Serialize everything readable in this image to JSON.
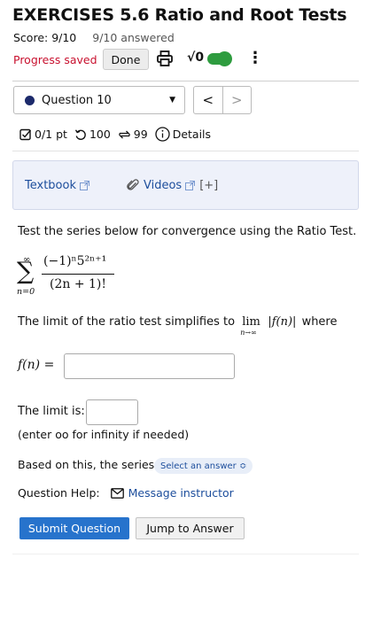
{
  "header": {
    "title": "EXERCISES 5.6 Ratio and Root Tests",
    "score": "Score: 9/10",
    "answered": "9/10 answered",
    "progress_saved": "Progress saved",
    "done_label": "Done",
    "sqrt_label": "√0",
    "kebab": "⋮"
  },
  "question_nav": {
    "selected": "Question 10",
    "prev": "<",
    "next": ">"
  },
  "stats": {
    "points": "0/1 pt",
    "retries": "100",
    "attempts": "99",
    "details": "Details"
  },
  "resources": {
    "textbook": "Textbook",
    "videos": "Videos",
    "expand": "[+]"
  },
  "question": {
    "prompt": "Test the series below for convergence using the Ratio Test.",
    "sum_upper": "∞",
    "sum_lower": "n=0",
    "numerator": "(−1)ⁿ5²ⁿ⁺¹",
    "denominator": "(2n + 1)!",
    "limit_text": "The limit of the ratio test simplifies to",
    "lim": "lim",
    "lim_sub": "n→∞",
    "abs_fn": "|f(n)|",
    "where": "where",
    "fn_label": "f(n) =",
    "fn_value": "",
    "limit_label": "The limit is:",
    "limit_value": "",
    "hint": "(enter oo for infinity if needed)",
    "based_on": "Based on this, the series",
    "select_placeholder": "Select an answer ≎"
  },
  "help": {
    "label": "Question Help:",
    "message": "Message instructor"
  },
  "actions": {
    "submit": "Submit Question",
    "jump": "Jump to Answer"
  },
  "colors": {
    "saved_red": "#c8102e",
    "link_blue": "#1d4e9c",
    "submit_blue": "#2773cc",
    "toggle_green": "#2e9c3f",
    "panel_bg": "#eef1fa"
  }
}
